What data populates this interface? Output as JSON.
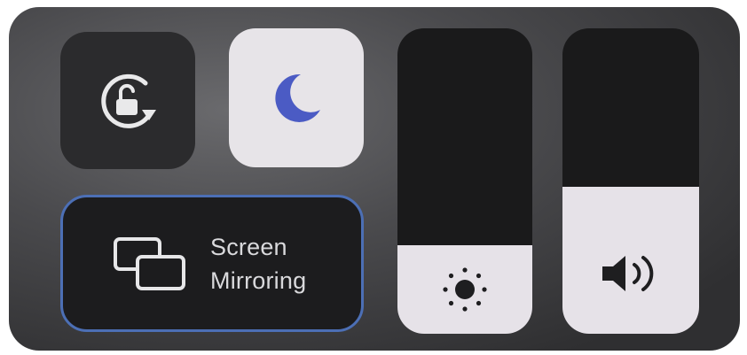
{
  "control_center": {
    "rotation_lock": {
      "icon": "rotation-lock-icon",
      "state": "off"
    },
    "do_not_disturb": {
      "icon": "moon-icon",
      "state": "on",
      "accent": "#4b5bc4"
    },
    "screen_mirroring": {
      "label_line1": "Screen",
      "label_line2": "Mirroring",
      "icon": "screen-mirroring-icon",
      "border_color": "#4c6fb5"
    },
    "brightness": {
      "icon": "sun-icon",
      "level": 0.29
    },
    "volume": {
      "icon": "speaker-icon",
      "level": 0.48
    }
  }
}
